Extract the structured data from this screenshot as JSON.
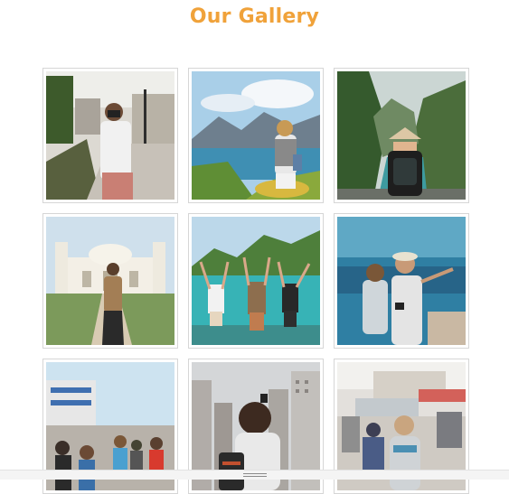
{
  "gallery": {
    "title": "Our Gallery",
    "photos": [
      {
        "icon": "photo-icon",
        "subject": "traveler-with-camera-city-street"
      },
      {
        "icon": "photo-icon",
        "subject": "traveler-at-lake-mountains"
      },
      {
        "icon": "photo-icon",
        "subject": "traveler-at-river-gorge"
      },
      {
        "icon": "photo-icon",
        "subject": "traveler-at-white-palace"
      },
      {
        "icon": "photo-icon",
        "subject": "friends-cheering-at-lake"
      },
      {
        "icon": "photo-icon",
        "subject": "couple-taking-selfie"
      },
      {
        "icon": "photo-icon",
        "subject": "crowd-on-boardwalk"
      },
      {
        "icon": "photo-icon",
        "subject": "traveler-photographing-city"
      },
      {
        "icon": "photo-icon",
        "subject": "traveler-in-busy-street"
      }
    ]
  },
  "colors": {
    "accent": "#f0a23a",
    "card_border": "#d6d6d6"
  },
  "footer": {
    "icon": "drag-handle-icon"
  }
}
